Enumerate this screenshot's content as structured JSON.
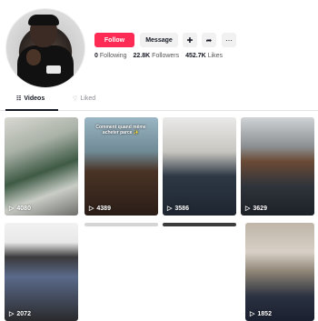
{
  "profile": {
    "follow_label": "Follow",
    "message_label": "Message",
    "add_friend_icon": "add-user-icon",
    "share_icon": "share-icon",
    "more_icon": "more-icon"
  },
  "stats": {
    "following_count": "0",
    "following_label": "Following",
    "followers_count": "22.8K",
    "followers_label": "Followers",
    "likes_count": "452.7K",
    "likes_label": "Likes"
  },
  "tabs": {
    "videos_label": "Videos",
    "liked_label": "Liked"
  },
  "videos": [
    {
      "views": "4080"
    },
    {
      "views": "4389",
      "caption": "Comment quand même\nacheter parce ✨"
    },
    {
      "views": "3586"
    },
    {
      "views": "3629"
    },
    {
      "views": "2072"
    },
    {
      "views": ""
    },
    {
      "views": ""
    },
    {
      "views": "1852"
    }
  ],
  "colors": {
    "accent": "#fe2c55",
    "text": "#161823",
    "secondary_button": "#f1f1f2"
  }
}
